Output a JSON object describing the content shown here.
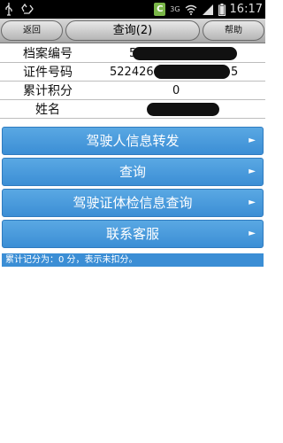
{
  "status_bar": {
    "time": "16:17",
    "network": "3G",
    "icons": [
      "usb-icon",
      "recycle-icon",
      "app-c-icon",
      "wifi-icon",
      "signal-icon",
      "battery-icon"
    ],
    "app_c_letter": "C"
  },
  "header": {
    "back_label": "返回",
    "title": "查询(2)",
    "help_label": "帮助"
  },
  "info_rows": [
    {
      "label": "档案编号",
      "value": "5"
    },
    {
      "label": "证件号码",
      "value": "522426",
      "value_suffix": "5"
    },
    {
      "label": "累计积分",
      "value": "0"
    },
    {
      "label": "姓名",
      "value": ""
    }
  ],
  "menu": {
    "items": [
      {
        "label": "驾驶人信息转发"
      },
      {
        "label": "查询"
      },
      {
        "label": "驾驶证体检信息查询"
      },
      {
        "label": "联系客服"
      }
    ]
  },
  "note": "累计记分为：0 分，表示未扣分。",
  "colors": {
    "accent": "#3b8ed5",
    "status_bar": "#000000",
    "redaction": "#111111"
  }
}
